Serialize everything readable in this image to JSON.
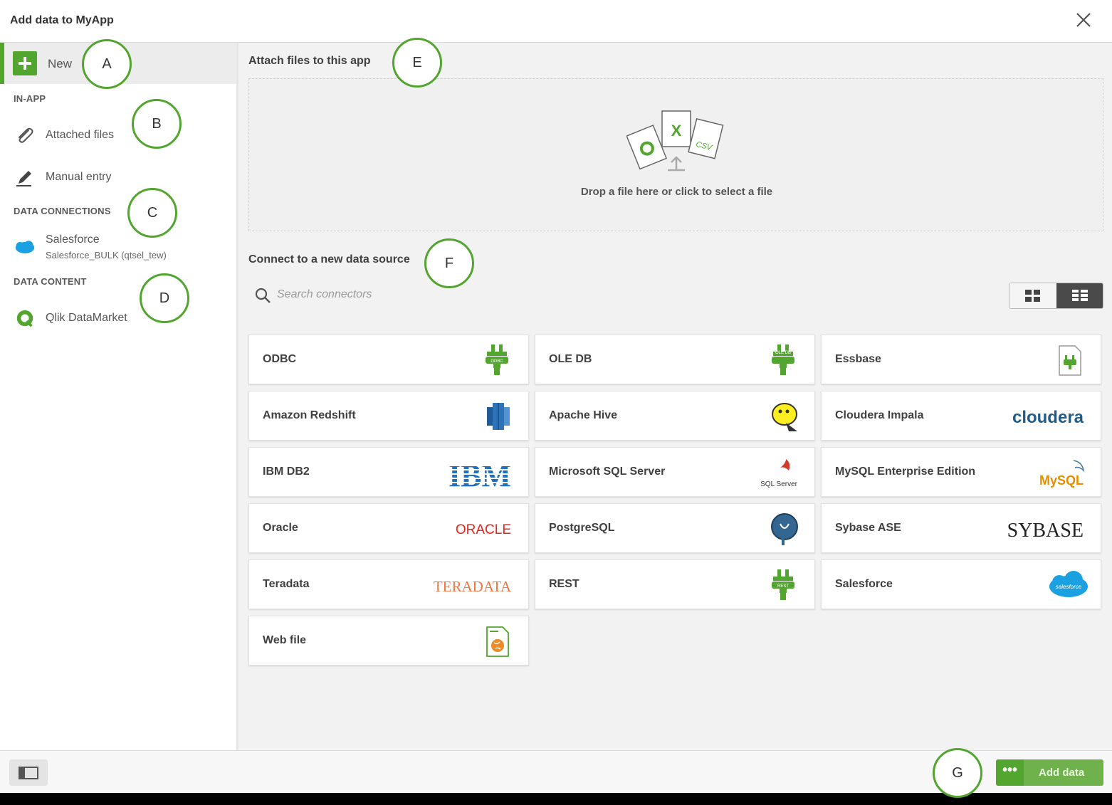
{
  "dialog": {
    "title": "Add data to MyApp"
  },
  "sidebar": {
    "new_label": "New",
    "in_app_header": "IN-APP",
    "attached_files": "Attached files",
    "manual_entry": "Manual entry",
    "data_connections_header": "DATA CONNECTIONS",
    "salesforce_name": "Salesforce",
    "salesforce_sub": "Salesforce_BULK (qtsel_tew)",
    "data_content_header": "DATA CONTENT",
    "qlik_datamarket": "Qlik DataMarket"
  },
  "main": {
    "attach_heading": "Attach files to this app",
    "drop_text": "Drop a file here or click to select a file",
    "connect_heading": "Connect to a new data source",
    "search_placeholder": "Search connectors"
  },
  "connectors": [
    {
      "name": "ODBC",
      "icon": "plug-icon",
      "tag": "ODBC"
    },
    {
      "name": "OLE DB",
      "icon": "plug-icon",
      "tag": "OLE DB"
    },
    {
      "name": "Essbase",
      "icon": "plug-doc-icon",
      "tag": ""
    },
    {
      "name": "Amazon Redshift",
      "icon": "redshift-icon",
      "tag": ""
    },
    {
      "name": "Apache Hive",
      "icon": "hive-icon",
      "tag": ""
    },
    {
      "name": "Cloudera Impala",
      "icon": "cloudera-logo",
      "tag": "cloudera"
    },
    {
      "name": "IBM DB2",
      "icon": "ibm-logo",
      "tag": "IBM"
    },
    {
      "name": "Microsoft SQL Server",
      "icon": "sqlserver-logo",
      "tag": "SQL Server"
    },
    {
      "name": "MySQL Enterprise Edition",
      "icon": "mysql-logo",
      "tag": "MySQL"
    },
    {
      "name": "Oracle",
      "icon": "oracle-logo",
      "tag": "ORACLE"
    },
    {
      "name": "PostgreSQL",
      "icon": "postgresql-icon",
      "tag": ""
    },
    {
      "name": "Sybase ASE",
      "icon": "sybase-logo",
      "tag": "SYBASE"
    },
    {
      "name": "Teradata",
      "icon": "teradata-logo",
      "tag": "TERADATA"
    },
    {
      "name": "REST",
      "icon": "plug-icon",
      "tag": "REST"
    },
    {
      "name": "Salesforce",
      "icon": "salesforce-logo",
      "tag": "salesforce"
    },
    {
      "name": "Web file",
      "icon": "web-file-icon",
      "tag": ""
    }
  ],
  "footer": {
    "add_data_label": "Add data",
    "dots": "•••"
  },
  "callouts": [
    "A",
    "B",
    "C",
    "D",
    "E",
    "F",
    "G"
  ],
  "colors": {
    "accent": "#52a52e",
    "add_data_bg": "#6fb14a",
    "background": "#f2f2f2"
  }
}
